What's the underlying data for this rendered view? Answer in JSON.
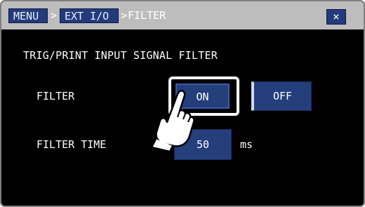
{
  "breadcrumb": {
    "menu_label": "MENU",
    "sep1": ">",
    "ext_label": "EXT I/O",
    "sep2": ">",
    "current_label": "FILTER"
  },
  "close": {
    "label": "×"
  },
  "section": {
    "heading": "TRIG/PRINT INPUT SIGNAL FILTER"
  },
  "filter": {
    "label": "FILTER",
    "on_label": "ON",
    "off_label": "OFF",
    "selected": "ON"
  },
  "filter_time": {
    "label": "FILTER TIME",
    "value": "50",
    "unit": "ms"
  },
  "colors": {
    "title_bg": "#bdbdbd",
    "button_bg": "#253e7c",
    "screen_bg": "#000000",
    "text": "#ffffff"
  },
  "icons": {
    "pointer": "pointing-hand-icon"
  }
}
